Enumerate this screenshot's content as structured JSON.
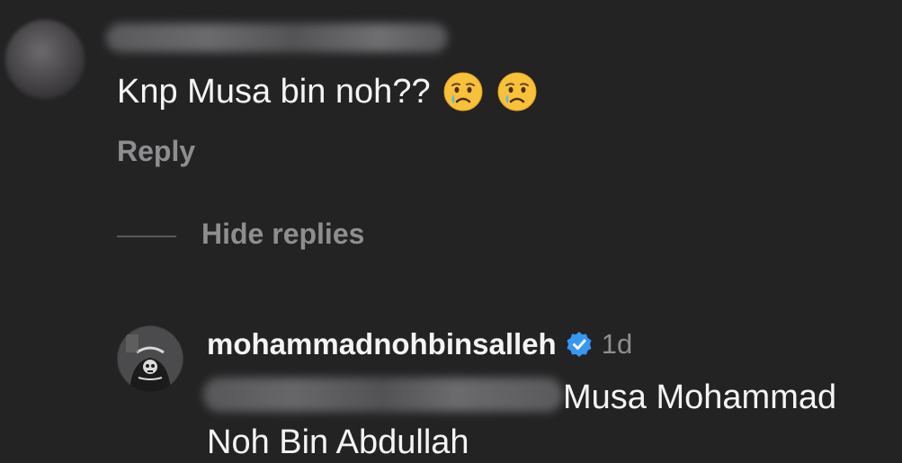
{
  "comment": {
    "text": "Knp Musa bin noh??",
    "emojis": [
      "crying-face-icon",
      "crying-face-icon"
    ],
    "reply_label": "Reply"
  },
  "thread": {
    "hide_replies_label": "Hide replies"
  },
  "reply": {
    "username": "mohammadnohbinsalleh",
    "verified": true,
    "time": "1d",
    "text_line1": "Musa Mohammad",
    "text_line2": "Noh Bin Abdullah",
    "avatar_icon": "skull-riders-avatar"
  },
  "colors": {
    "background": "#232324",
    "text_primary": "#f4f4f5",
    "text_secondary": "#8e8e90",
    "verified_blue": "#3897f0"
  }
}
